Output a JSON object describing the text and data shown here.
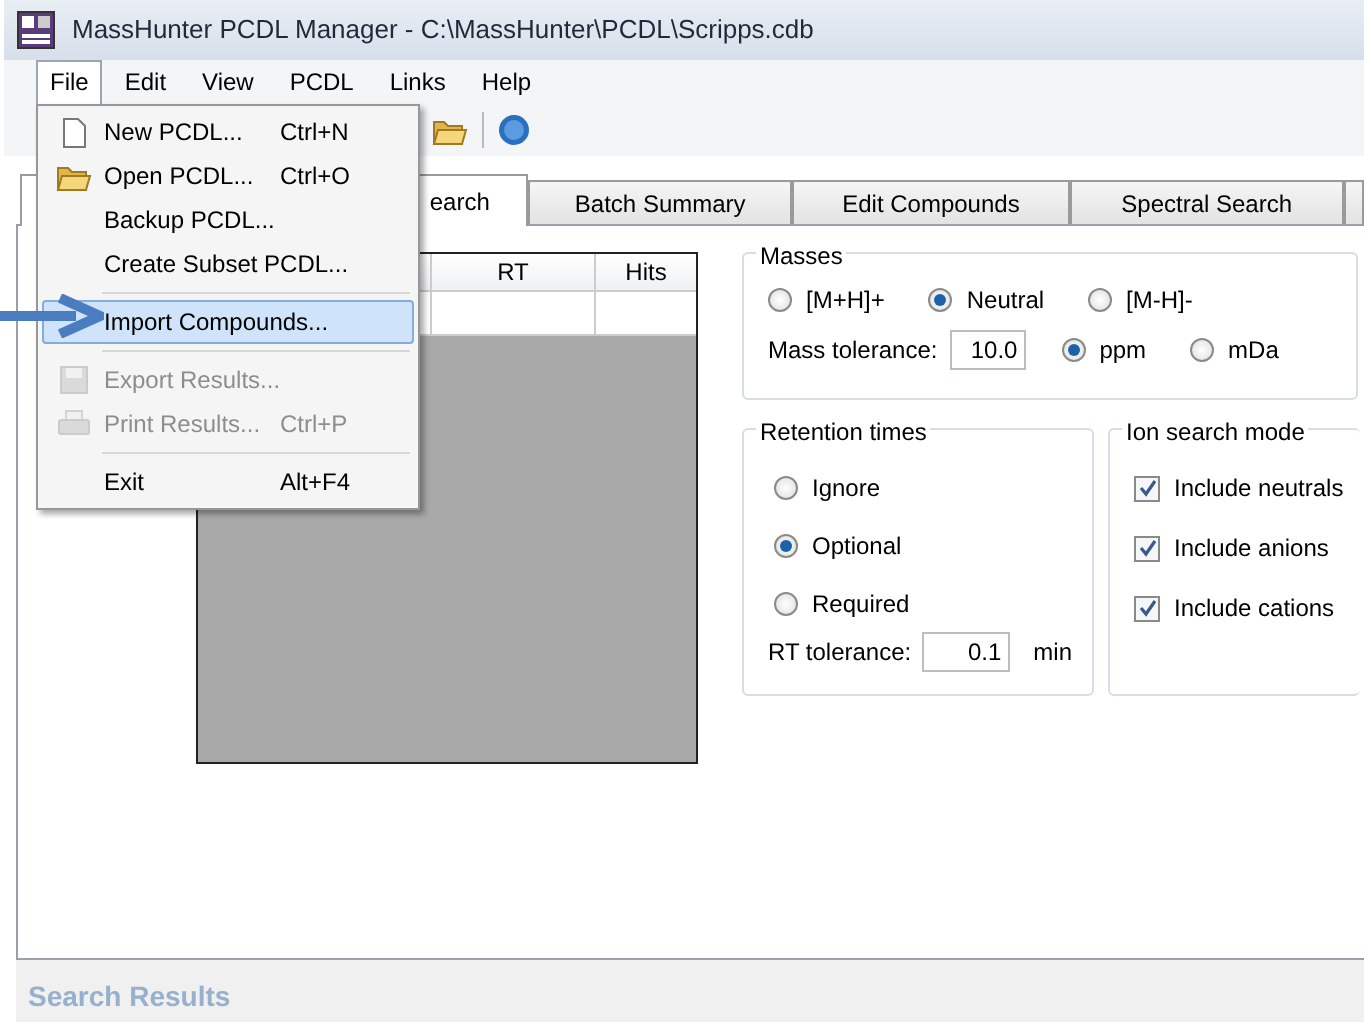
{
  "window": {
    "title": "MassHunter PCDL Manager - C:\\MassHunter\\PCDL\\Scripps.cdb"
  },
  "menubar": [
    {
      "label": "File",
      "selected": true
    },
    {
      "label": "Edit",
      "selected": false
    },
    {
      "label": "View",
      "selected": false
    },
    {
      "label": "PCDL",
      "selected": false
    },
    {
      "label": "Links",
      "selected": false
    },
    {
      "label": "Help",
      "selected": false
    }
  ],
  "file_menu": [
    [
      {
        "kind": "new",
        "label": "New PCDL...",
        "shortcut": "Ctrl+N",
        "disabled": false,
        "selected": false
      },
      {
        "kind": "open",
        "label": "Open PCDL...",
        "shortcut": "Ctrl+O",
        "disabled": false,
        "selected": false
      },
      {
        "kind": "plain",
        "label": "Backup PCDL...",
        "disabled": false,
        "selected": false
      },
      {
        "kind": "plain",
        "label": "Create Subset PCDL...",
        "disabled": false,
        "selected": false
      }
    ],
    [
      {
        "kind": "plain",
        "label": "Import Compounds...",
        "disabled": false,
        "selected": true
      }
    ],
    [
      {
        "kind": "save",
        "label": "Export Results...",
        "disabled": true,
        "selected": false
      },
      {
        "kind": "print",
        "label": "Print Results...",
        "shortcut": "Ctrl+P",
        "disabled": true,
        "selected": false
      }
    ],
    [
      {
        "kind": "plain",
        "label": "Exit",
        "shortcut": "Alt+F4",
        "disabled": false,
        "selected": false
      }
    ]
  ],
  "tabs": [
    {
      "label": "earch",
      "selected": true
    },
    {
      "label": "Batch Summary",
      "selected": false
    },
    {
      "label": "Edit Compounds",
      "selected": false
    },
    {
      "label": "Spectral Search",
      "selected": false
    }
  ],
  "table": {
    "columns": [
      "RT",
      "Hits"
    ]
  },
  "masses": {
    "title": "Masses",
    "options": [
      {
        "label": "[M+H]+",
        "selected": false
      },
      {
        "label": "Neutral",
        "selected": true
      },
      {
        "label": "[M-H]-",
        "selected": false
      }
    ],
    "tolerance_label": "Mass tolerance:",
    "tolerance": "10.0",
    "units": [
      {
        "label": "ppm",
        "selected": true
      },
      {
        "label": "mDa",
        "selected": false
      }
    ]
  },
  "retention_times": {
    "title": "Retention times",
    "options": [
      {
        "label": "Ignore",
        "selected": false
      },
      {
        "label": "Optional",
        "selected": true
      },
      {
        "label": "Required",
        "selected": false
      }
    ],
    "tolerance_label": "RT tolerance:",
    "tolerance": "0.1",
    "unit": "min"
  },
  "ion_search_mode": {
    "title": "Ion search mode",
    "options": [
      {
        "label": "Include neutrals",
        "checked": true
      },
      {
        "label": "Include anions",
        "checked": true
      },
      {
        "label": "Include cations",
        "checked": true
      }
    ]
  },
  "results_header": "Search Results"
}
